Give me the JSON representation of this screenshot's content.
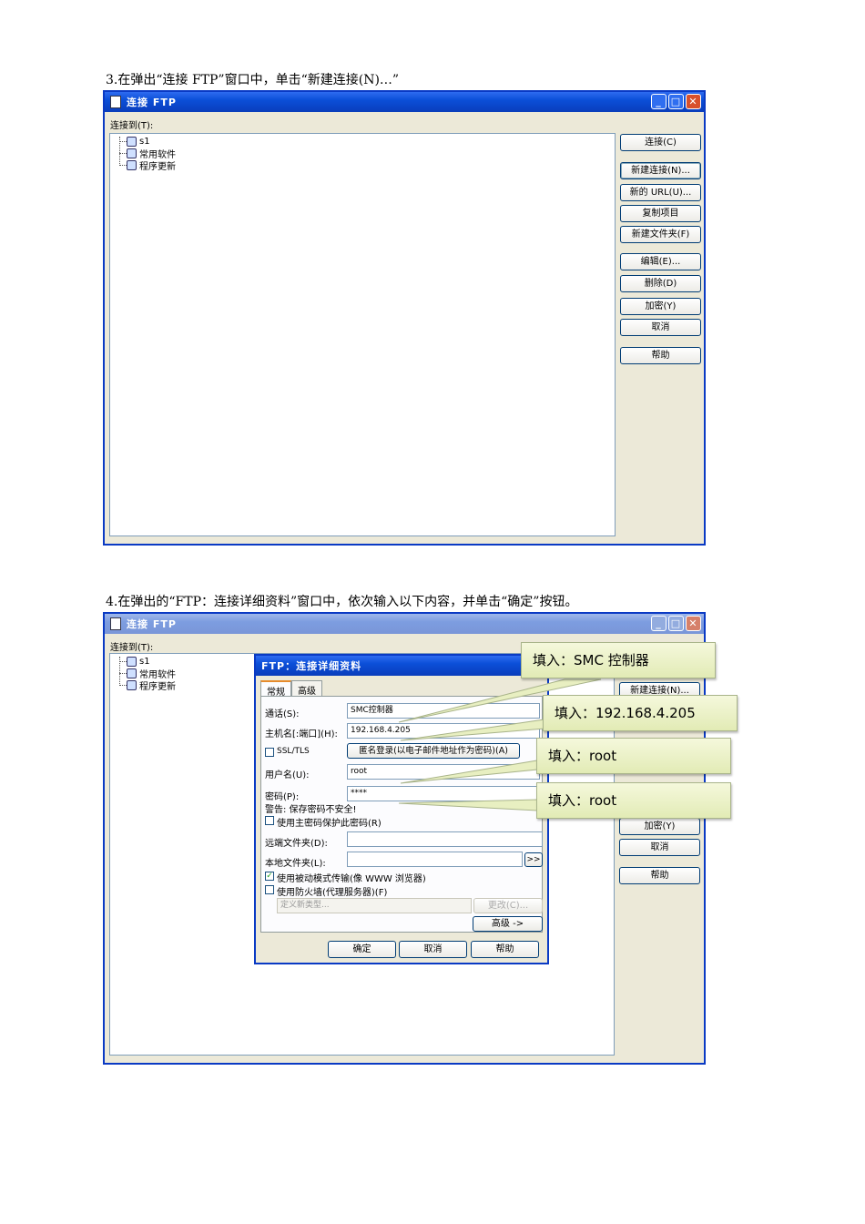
{
  "step3": {
    "caption": "3.在弹出“连接 FTP”窗口中，单击“新建连接(N)…”",
    "window_title": "连接  FTP",
    "connect_to_label": "连接到(T):",
    "tree_items": [
      "s1",
      "常用软件",
      "程序更新"
    ],
    "buttons": [
      "连接(C)",
      "新建连接(N)...",
      "新的 URL(U)...",
      "复制项目",
      "新建文件夹(F)",
      "编辑(E)...",
      "删除(D)",
      "加密(Y)",
      "取消",
      "帮助"
    ]
  },
  "step4": {
    "caption": "4.在弹出的“FTP：连接详细资料”窗口中，依次输入以下内容，并单击“确定”按钮。",
    "window_title": "连接  FTP",
    "connect_to_label": "连接到(T):",
    "tree_items": [
      "s1",
      "常用软件",
      "程序更新"
    ],
    "side_buttons": [
      "新建连接(N)...",
      "加密(Y)",
      "取消",
      "帮助"
    ],
    "dialog": {
      "title": "FTP：连接详细资料",
      "tabs": [
        "常规",
        "高级"
      ],
      "labels": {
        "name": "通话(S):",
        "host": "主机名[:端口](H):",
        "ssl": "SSL/TLS",
        "user": "用户名(U):",
        "password": "密码(P):",
        "warning": "警告: 保存密码不安全!",
        "master": "使用主密码保护此密码(R)",
        "remote": "远端文件夹(D):",
        "local": "本地文件夹(L):",
        "passive": "使用被动模式传输(像 WWW 浏览器)",
        "firewall": "使用防火墙(代理服务器)(F)"
      },
      "values": {
        "name": "SMC控制器",
        "host": "192.168.4.205",
        "user": "root",
        "password": "****",
        "remote": "",
        "local": ""
      },
      "anonymous_button": "匿名登录(以电子邮件地址作为密码)(A)",
      "browse_button": ">>",
      "proxy_placeholder": "定义新类型...",
      "change_button": "更改(C)...",
      "advanced_button": "高级 ->",
      "ok_button": "确定",
      "cancel_button": "取消",
      "help_button": "帮助"
    },
    "callouts": [
      "填入：SMC 控制器",
      "填入：192.168.4.205",
      "填入：root",
      "填入：root"
    ]
  }
}
